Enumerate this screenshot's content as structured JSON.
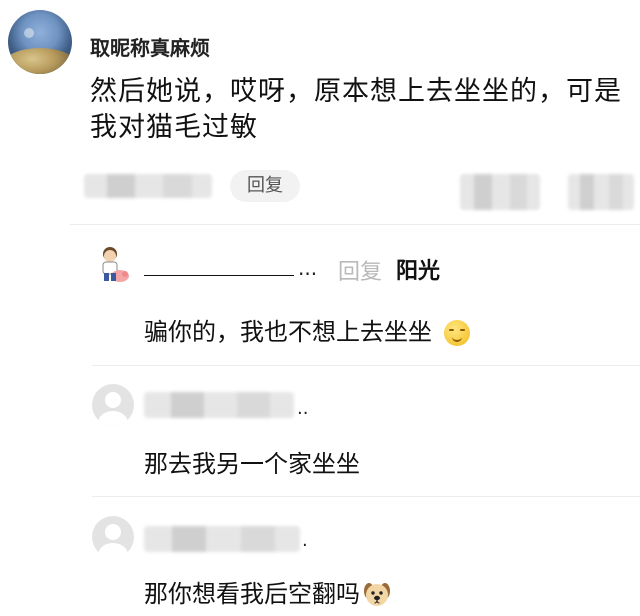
{
  "main_comment": {
    "username": "取昵称真麻烦",
    "text": "然后她说，哎呀，原本想上去坐坐的，可是我对猫毛过敏",
    "reply_label": "回复"
  },
  "replies": [
    {
      "username_trail": "...",
      "reply_word": "回复",
      "reply_target": "阳光",
      "text": "骗你的，我也不想上去坐坐",
      "emoji": "smirk-emoji"
    },
    {
      "username_trail": "..",
      "text": "那去我另一个家坐坐"
    },
    {
      "username_trail": ".",
      "text": "那你想看我后空翻吗",
      "emoji": "dog-emoji"
    }
  ],
  "colors": {
    "divider": "#ececec",
    "reply_pill_bg": "#f2f2f2",
    "muted_text": "#b9b9b9"
  }
}
